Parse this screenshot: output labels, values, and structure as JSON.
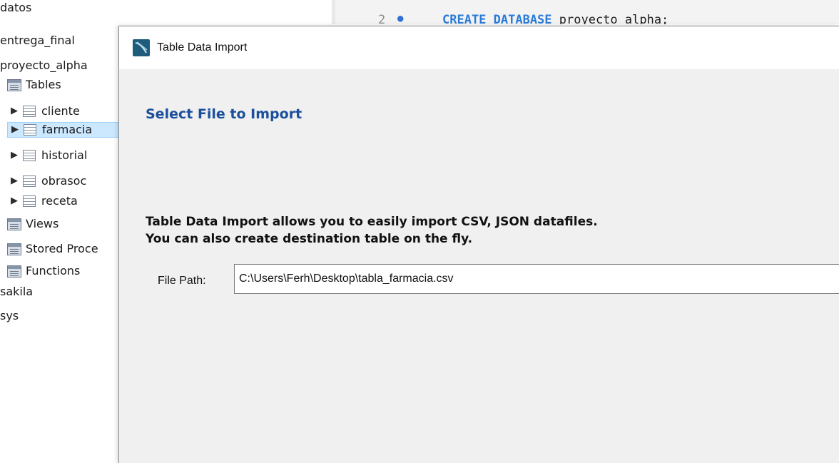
{
  "navigator": {
    "items": [
      {
        "label": "datos",
        "type": "schema"
      },
      {
        "label": "entrega_final",
        "type": "schema"
      },
      {
        "label": "proyecto_alpha",
        "type": "schema"
      },
      {
        "label": "Tables",
        "type": "group"
      },
      {
        "label": "cliente",
        "type": "table"
      },
      {
        "label": "farmacia",
        "type": "table",
        "selected": true
      },
      {
        "label": "historial",
        "type": "table"
      },
      {
        "label": "obrasoc",
        "type": "table"
      },
      {
        "label": "receta",
        "type": "table"
      },
      {
        "label": "Views",
        "type": "group"
      },
      {
        "label": "Stored Proce",
        "type": "group"
      },
      {
        "label": "Functions",
        "type": "group"
      },
      {
        "label": "sakila",
        "type": "schema"
      },
      {
        "label": "sys",
        "type": "schema"
      }
    ]
  },
  "editor": {
    "line_number": "2",
    "code_keyword": "CREATE DATABASE",
    "code_rest": " proyecto_alpha;"
  },
  "dialog": {
    "title": "Table Data Import",
    "heading": "Select File to Import",
    "description_line1": "Table Data Import allows you to easily import CSV, JSON datafiles.",
    "description_line2": "You can also create destination table on the fly.",
    "file_path_label": "File Path:",
    "file_path_value": "C:\\Users\\Ferh\\Desktop\\tabla_farmacia.csv"
  },
  "colors": {
    "heading": "#1b4f9c",
    "selection": "#cce8ff",
    "keyword": "#2a7bd8"
  }
}
